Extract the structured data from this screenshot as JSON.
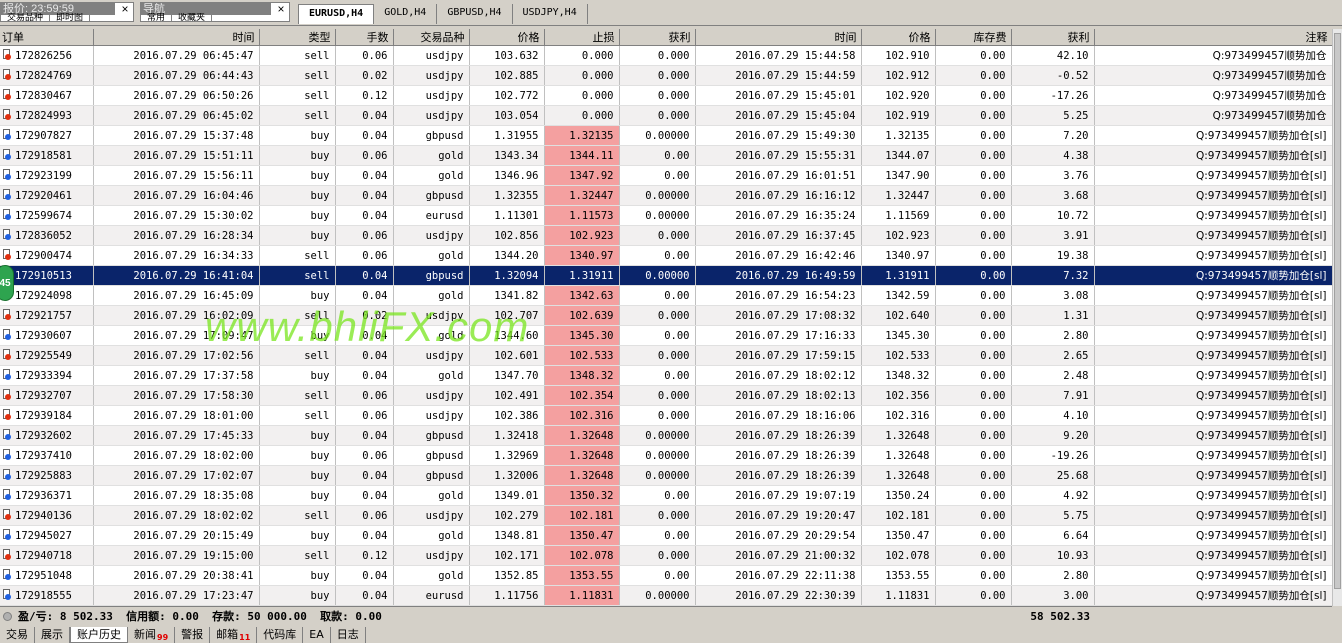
{
  "top": {
    "quote_panel_title": "报价: 23:59:59",
    "quote_panel_tabs": [
      "交易品种",
      "即时图"
    ],
    "nav_panel_title": "导航",
    "nav_panel_tabs": [
      "常用",
      "收藏夹"
    ],
    "chart_tabs": [
      {
        "label": "EURUSD,H4",
        "active": true
      },
      {
        "label": "GOLD,H4",
        "active": false
      },
      {
        "label": "GBPUSD,H4",
        "active": false
      },
      {
        "label": "USDJPY,H4",
        "active": false
      }
    ]
  },
  "columns": [
    "订单",
    "时间",
    "类型",
    "手数",
    "交易品种",
    "价格",
    "止损",
    "获利",
    "时间",
    "价格",
    "库存费",
    "获利",
    "注释"
  ],
  "rows": [
    {
      "ticket": "172826256",
      "open_time": "2016.07.29 06:45:47",
      "type": "sell",
      "lots": "0.06",
      "symbol": "usdjpy",
      "open_price": "103.632",
      "sl": "0.000",
      "tp": "0.000",
      "close_time": "2016.07.29 15:44:58",
      "close_price": "102.910",
      "swap": "0.00",
      "profit": "42.10",
      "comment": "Q:973499457顺势加仓",
      "sl_hit": false
    },
    {
      "ticket": "172824769",
      "open_time": "2016.07.29 06:44:43",
      "type": "sell",
      "lots": "0.02",
      "symbol": "usdjpy",
      "open_price": "102.885",
      "sl": "0.000",
      "tp": "0.000",
      "close_time": "2016.07.29 15:44:59",
      "close_price": "102.912",
      "swap": "0.00",
      "profit": "-0.52",
      "comment": "Q:973499457顺势加仓",
      "sl_hit": false
    },
    {
      "ticket": "172830467",
      "open_time": "2016.07.29 06:50:26",
      "type": "sell",
      "lots": "0.12",
      "symbol": "usdjpy",
      "open_price": "102.772",
      "sl": "0.000",
      "tp": "0.000",
      "close_time": "2016.07.29 15:45:01",
      "close_price": "102.920",
      "swap": "0.00",
      "profit": "-17.26",
      "comment": "Q:973499457顺势加仓",
      "sl_hit": false
    },
    {
      "ticket": "172824993",
      "open_time": "2016.07.29 06:45:02",
      "type": "sell",
      "lots": "0.04",
      "symbol": "usdjpy",
      "open_price": "103.054",
      "sl": "0.000",
      "tp": "0.000",
      "close_time": "2016.07.29 15:45:04",
      "close_price": "102.919",
      "swap": "0.00",
      "profit": "5.25",
      "comment": "Q:973499457顺势加仓",
      "sl_hit": false
    },
    {
      "ticket": "172907827",
      "open_time": "2016.07.29 15:37:48",
      "type": "buy",
      "lots": "0.04",
      "symbol": "gbpusd",
      "open_price": "1.31955",
      "sl": "1.32135",
      "tp": "0.00000",
      "close_time": "2016.07.29 15:49:30",
      "close_price": "1.32135",
      "swap": "0.00",
      "profit": "7.20",
      "comment": "Q:973499457顺势加仓[sl]",
      "sl_hit": true
    },
    {
      "ticket": "172918581",
      "open_time": "2016.07.29 15:51:11",
      "type": "buy",
      "lots": "0.06",
      "symbol": "gold",
      "open_price": "1343.34",
      "sl": "1344.11",
      "tp": "0.00",
      "close_time": "2016.07.29 15:55:31",
      "close_price": "1344.07",
      "swap": "0.00",
      "profit": "4.38",
      "comment": "Q:973499457顺势加仓[sl]",
      "sl_hit": true
    },
    {
      "ticket": "172923199",
      "open_time": "2016.07.29 15:56:11",
      "type": "buy",
      "lots": "0.04",
      "symbol": "gold",
      "open_price": "1346.96",
      "sl": "1347.92",
      "tp": "0.00",
      "close_time": "2016.07.29 16:01:51",
      "close_price": "1347.90",
      "swap": "0.00",
      "profit": "3.76",
      "comment": "Q:973499457顺势加仓[sl]",
      "sl_hit": true
    },
    {
      "ticket": "172920461",
      "open_time": "2016.07.29 16:04:46",
      "type": "buy",
      "lots": "0.04",
      "symbol": "gbpusd",
      "open_price": "1.32355",
      "sl": "1.32447",
      "tp": "0.00000",
      "close_time": "2016.07.29 16:16:12",
      "close_price": "1.32447",
      "swap": "0.00",
      "profit": "3.68",
      "comment": "Q:973499457顺势加仓[sl]",
      "sl_hit": true
    },
    {
      "ticket": "172599674",
      "open_time": "2016.07.29 15:30:02",
      "type": "buy",
      "lots": "0.04",
      "symbol": "eurusd",
      "open_price": "1.11301",
      "sl": "1.11573",
      "tp": "0.00000",
      "close_time": "2016.07.29 16:35:24",
      "close_price": "1.11569",
      "swap": "0.00",
      "profit": "10.72",
      "comment": "Q:973499457顺势加仓[sl]",
      "sl_hit": true
    },
    {
      "ticket": "172836052",
      "open_time": "2016.07.29 16:28:34",
      "type": "buy",
      "lots": "0.06",
      "symbol": "usdjpy",
      "open_price": "102.856",
      "sl": "102.923",
      "tp": "0.000",
      "close_time": "2016.07.29 16:37:45",
      "close_price": "102.923",
      "swap": "0.00",
      "profit": "3.91",
      "comment": "Q:973499457顺势加仓[sl]",
      "sl_hit": true
    },
    {
      "ticket": "172900474",
      "open_time": "2016.07.29 16:34:33",
      "type": "sell",
      "lots": "0.06",
      "symbol": "gold",
      "open_price": "1344.20",
      "sl": "1340.97",
      "tp": "0.00",
      "close_time": "2016.07.29 16:42:46",
      "close_price": "1340.97",
      "swap": "0.00",
      "profit": "19.38",
      "comment": "Q:973499457顺势加仓[sl]",
      "sl_hit": true
    },
    {
      "ticket": "172910513",
      "open_time": "2016.07.29 16:41:04",
      "type": "sell",
      "lots": "0.04",
      "symbol": "gbpusd",
      "open_price": "1.32094",
      "sl": "1.31911",
      "tp": "0.00000",
      "close_time": "2016.07.29 16:49:59",
      "close_price": "1.31911",
      "swap": "0.00",
      "profit": "7.32",
      "comment": "Q:973499457顺势加仓[sl]",
      "sl_hit": true,
      "selected": true
    },
    {
      "ticket": "172924098",
      "open_time": "2016.07.29 16:45:09",
      "type": "buy",
      "lots": "0.04",
      "symbol": "gold",
      "open_price": "1341.82",
      "sl": "1342.63",
      "tp": "0.00",
      "close_time": "2016.07.29 16:54:23",
      "close_price": "1342.59",
      "swap": "0.00",
      "profit": "3.08",
      "comment": "Q:973499457顺势加仓[sl]",
      "sl_hit": true
    },
    {
      "ticket": "172921757",
      "open_time": "2016.07.29 16:02:09",
      "type": "sell",
      "lots": "0.02",
      "symbol": "usdjpy",
      "open_price": "102.707",
      "sl": "102.639",
      "tp": "0.000",
      "close_time": "2016.07.29 17:08:32",
      "close_price": "102.640",
      "swap": "0.00",
      "profit": "1.31",
      "comment": "Q:973499457顺势加仓[sl]",
      "sl_hit": true
    },
    {
      "ticket": "172930607",
      "open_time": "2016.07.29 17:09:47",
      "type": "buy",
      "lots": "0.04",
      "symbol": "gold",
      "open_price": "1344.60",
      "sl": "1345.30",
      "tp": "0.00",
      "close_time": "2016.07.29 17:16:33",
      "close_price": "1345.30",
      "swap": "0.00",
      "profit": "2.80",
      "comment": "Q:973499457顺势加仓[sl]",
      "sl_hit": true
    },
    {
      "ticket": "172925549",
      "open_time": "2016.07.29 17:02:56",
      "type": "sell",
      "lots": "0.04",
      "symbol": "usdjpy",
      "open_price": "102.601",
      "sl": "102.533",
      "tp": "0.000",
      "close_time": "2016.07.29 17:59:15",
      "close_price": "102.533",
      "swap": "0.00",
      "profit": "2.65",
      "comment": "Q:973499457顺势加仓[sl]",
      "sl_hit": true
    },
    {
      "ticket": "172933394",
      "open_time": "2016.07.29 17:37:58",
      "type": "buy",
      "lots": "0.04",
      "symbol": "gold",
      "open_price": "1347.70",
      "sl": "1348.32",
      "tp": "0.00",
      "close_time": "2016.07.29 18:02:12",
      "close_price": "1348.32",
      "swap": "0.00",
      "profit": "2.48",
      "comment": "Q:973499457顺势加仓[sl]",
      "sl_hit": true
    },
    {
      "ticket": "172932707",
      "open_time": "2016.07.29 17:58:30",
      "type": "sell",
      "lots": "0.06",
      "symbol": "usdjpy",
      "open_price": "102.491",
      "sl": "102.354",
      "tp": "0.000",
      "close_time": "2016.07.29 18:02:13",
      "close_price": "102.356",
      "swap": "0.00",
      "profit": "7.91",
      "comment": "Q:973499457顺势加仓[sl]",
      "sl_hit": true
    },
    {
      "ticket": "172939184",
      "open_time": "2016.07.29 18:01:00",
      "type": "sell",
      "lots": "0.06",
      "symbol": "usdjpy",
      "open_price": "102.386",
      "sl": "102.316",
      "tp": "0.000",
      "close_time": "2016.07.29 18:16:06",
      "close_price": "102.316",
      "swap": "0.00",
      "profit": "4.10",
      "comment": "Q:973499457顺势加仓[sl]",
      "sl_hit": true
    },
    {
      "ticket": "172932602",
      "open_time": "2016.07.29 17:45:33",
      "type": "buy",
      "lots": "0.04",
      "symbol": "gbpusd",
      "open_price": "1.32418",
      "sl": "1.32648",
      "tp": "0.00000",
      "close_time": "2016.07.29 18:26:39",
      "close_price": "1.32648",
      "swap": "0.00",
      "profit": "9.20",
      "comment": "Q:973499457顺势加仓[sl]",
      "sl_hit": true
    },
    {
      "ticket": "172937410",
      "open_time": "2016.07.29 18:02:00",
      "type": "buy",
      "lots": "0.06",
      "symbol": "gbpusd",
      "open_price": "1.32969",
      "sl": "1.32648",
      "tp": "0.00000",
      "close_time": "2016.07.29 18:26:39",
      "close_price": "1.32648",
      "swap": "0.00",
      "profit": "-19.26",
      "comment": "Q:973499457顺势加仓[sl]",
      "sl_hit": true
    },
    {
      "ticket": "172925883",
      "open_time": "2016.07.29 17:02:07",
      "type": "buy",
      "lots": "0.04",
      "symbol": "gbpusd",
      "open_price": "1.32006",
      "sl": "1.32648",
      "tp": "0.00000",
      "close_time": "2016.07.29 18:26:39",
      "close_price": "1.32648",
      "swap": "0.00",
      "profit": "25.68",
      "comment": "Q:973499457顺势加仓[sl]",
      "sl_hit": true
    },
    {
      "ticket": "172936371",
      "open_time": "2016.07.29 18:35:08",
      "type": "buy",
      "lots": "0.04",
      "symbol": "gold",
      "open_price": "1349.01",
      "sl": "1350.32",
      "tp": "0.00",
      "close_time": "2016.07.29 19:07:19",
      "close_price": "1350.24",
      "swap": "0.00",
      "profit": "4.92",
      "comment": "Q:973499457顺势加仓[sl]",
      "sl_hit": true
    },
    {
      "ticket": "172940136",
      "open_time": "2016.07.29 18:02:02",
      "type": "sell",
      "lots": "0.06",
      "symbol": "usdjpy",
      "open_price": "102.279",
      "sl": "102.181",
      "tp": "0.000",
      "close_time": "2016.07.29 19:20:47",
      "close_price": "102.181",
      "swap": "0.00",
      "profit": "5.75",
      "comment": "Q:973499457顺势加仓[sl]",
      "sl_hit": true
    },
    {
      "ticket": "172945027",
      "open_time": "2016.07.29 20:15:49",
      "type": "buy",
      "lots": "0.04",
      "symbol": "gold",
      "open_price": "1348.81",
      "sl": "1350.47",
      "tp": "0.00",
      "close_time": "2016.07.29 20:29:54",
      "close_price": "1350.47",
      "swap": "0.00",
      "profit": "6.64",
      "comment": "Q:973499457顺势加仓[sl]",
      "sl_hit": true
    },
    {
      "ticket": "172940718",
      "open_time": "2016.07.29 19:15:00",
      "type": "sell",
      "lots": "0.12",
      "symbol": "usdjpy",
      "open_price": "102.171",
      "sl": "102.078",
      "tp": "0.000",
      "close_time": "2016.07.29 21:00:32",
      "close_price": "102.078",
      "swap": "0.00",
      "profit": "10.93",
      "comment": "Q:973499457顺势加仓[sl]",
      "sl_hit": true
    },
    {
      "ticket": "172951048",
      "open_time": "2016.07.29 20:38:41",
      "type": "buy",
      "lots": "0.04",
      "symbol": "gold",
      "open_price": "1352.85",
      "sl": "1353.55",
      "tp": "0.00",
      "close_time": "2016.07.29 22:11:38",
      "close_price": "1353.55",
      "swap": "0.00",
      "profit": "2.80",
      "comment": "Q:973499457顺势加仓[sl]",
      "sl_hit": true
    },
    {
      "ticket": "172918555",
      "open_time": "2016.07.29 17:23:47",
      "type": "buy",
      "lots": "0.04",
      "symbol": "eurusd",
      "open_price": "1.11756",
      "sl": "1.11831",
      "tp": "0.00000",
      "close_time": "2016.07.29 22:30:39",
      "close_price": "1.11831",
      "swap": "0.00",
      "profit": "3.00",
      "comment": "Q:973499457顺势加仓[sl]",
      "sl_hit": true
    }
  ],
  "side_badge": "45",
  "watermark": "www.bhliFX.com",
  "summary": {
    "text": "盈/亏: 8 502.33  信用额: 0.00  存款: 50 000.00  取款: 0.00",
    "total": "58 502.33"
  },
  "bottom_tabs": [
    {
      "label": "交易",
      "active": false
    },
    {
      "label": "展示",
      "active": false
    },
    {
      "label": "账户历史",
      "active": true
    },
    {
      "label": "新闻",
      "active": false,
      "badge": "99"
    },
    {
      "label": "警报",
      "active": false
    },
    {
      "label": "邮箱",
      "active": false,
      "badge": "11"
    },
    {
      "label": "代码库",
      "active": false
    },
    {
      "label": "EA",
      "active": false
    },
    {
      "label": "日志",
      "active": false
    }
  ],
  "colors": {
    "selected_row": "#0a246a",
    "sl_hit_cell": "#f4a0a0",
    "sell_icon": "#e03010",
    "buy_icon": "#2060e0",
    "watermark": "#78e61e"
  }
}
